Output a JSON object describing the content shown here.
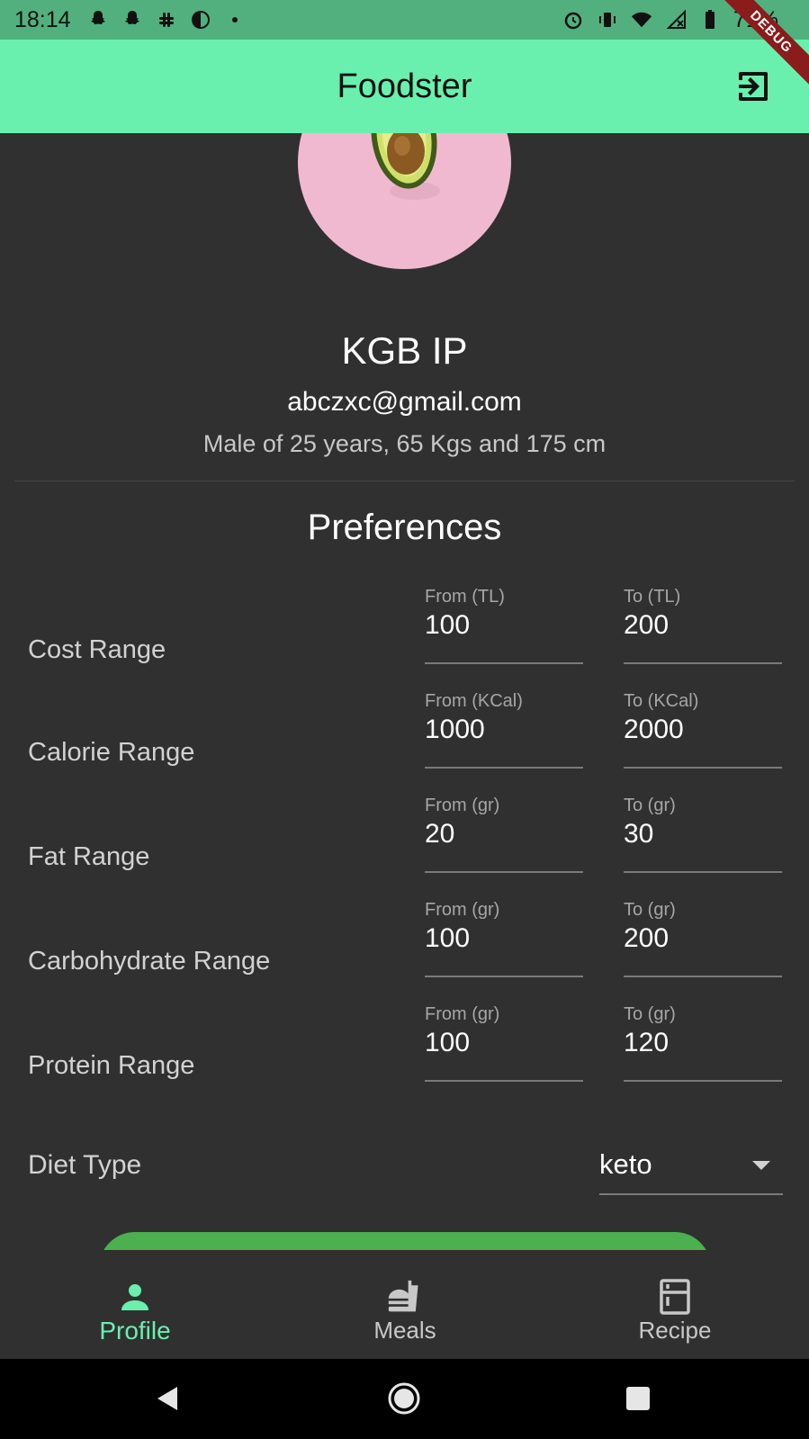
{
  "status_bar": {
    "time": "18:14",
    "battery": "71%",
    "left_icons": [
      "snapchat-icon",
      "snapchat-icon",
      "slack-icon",
      "circle-half-icon",
      "dot-icon"
    ],
    "right_icons": [
      "alarm-icon",
      "vibrate-icon",
      "wifi-icon",
      "signal-icon",
      "battery-icon"
    ],
    "debug_label": "DEBUG"
  },
  "app_bar": {
    "title": "Foodster",
    "logout_icon": "logout-icon"
  },
  "profile": {
    "name": "KGB IP",
    "email": "abczxc@gmail.com",
    "details": "Male of 25 years, 65 Kgs and 175 cm",
    "avatar": "avocado-image"
  },
  "preferences": {
    "title": "Preferences",
    "ranges": [
      {
        "label": "Cost Range",
        "from_label": "From (TL)",
        "from_value": "100",
        "to_label": "To (TL)",
        "to_value": "200"
      },
      {
        "label": "Calorie Range",
        "from_label": "From (KCal)",
        "from_value": "1000",
        "to_label": "To (KCal)",
        "to_value": "2000"
      },
      {
        "label": "Fat Range",
        "from_label": "From (gr)",
        "from_value": "20",
        "to_label": "To (gr)",
        "to_value": "30"
      },
      {
        "label": "Carbohydrate Range",
        "from_label": "From (gr)",
        "from_value": "100",
        "to_label": "To (gr)",
        "to_value": "200"
      },
      {
        "label": "Protein Range",
        "from_label": "From (gr)",
        "from_value": "100",
        "to_label": "To (gr)",
        "to_value": "120"
      }
    ],
    "diet": {
      "label": "Diet Type",
      "value": "keto"
    }
  },
  "colors": {
    "accent": "#69f0ae",
    "status_bar": "#51b07e",
    "background": "#303030",
    "button": "#4caf50"
  },
  "bottom_nav": [
    {
      "label": "Profile",
      "icon": "person-icon",
      "active": true
    },
    {
      "label": "Meals",
      "icon": "fastfood-icon",
      "active": false
    },
    {
      "label": "Recipe",
      "icon": "kitchen-icon",
      "active": false
    }
  ],
  "system_nav": [
    "back-icon",
    "home-icon",
    "recents-icon"
  ]
}
